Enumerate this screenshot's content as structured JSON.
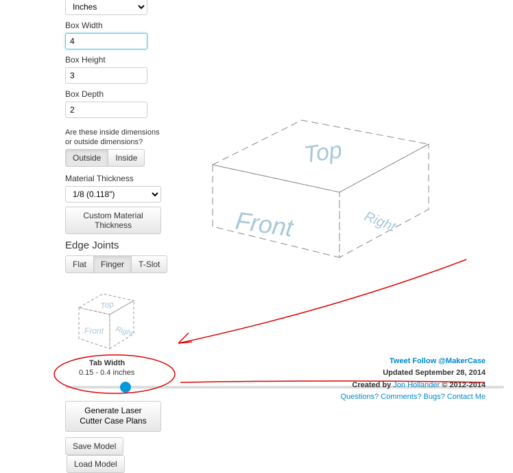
{
  "units": {
    "selected": "Inches"
  },
  "width": {
    "label": "Box Width",
    "value": "4"
  },
  "height": {
    "label": "Box Height",
    "value": "3"
  },
  "depth": {
    "label": "Box Depth",
    "value": "2"
  },
  "dims_q": "Are these inside dimensions or outside dimensions?",
  "dim_buttons": {
    "outside": "Outside",
    "inside": "Inside"
  },
  "thickness": {
    "label": "Material Thickness",
    "selected": "1/8 (0.118\")"
  },
  "custom_thick": "Custom Material Thickness",
  "edge": {
    "title": "Edge Joints",
    "flat": "Flat",
    "finger": "Finger",
    "tslot": "T-Slot"
  },
  "tab_width": {
    "label": "Tab Width",
    "range": "0.15 - 0.4 inches"
  },
  "generate": "Generate Laser Cutter Case Plans",
  "save": "Save Model",
  "load": "Load Model",
  "preview": {
    "top": "Top",
    "front": "Front",
    "right": "Right"
  },
  "footer": {
    "tweet": "Tweet",
    "follow": "Follow @MakerCase",
    "updated": "Updated September 28, 2014",
    "created": "Created by ",
    "author": "Jon Hollander",
    "copy": " © 2012-2014",
    "contact": "Questions? Comments? Bugs? Contact Me"
  }
}
